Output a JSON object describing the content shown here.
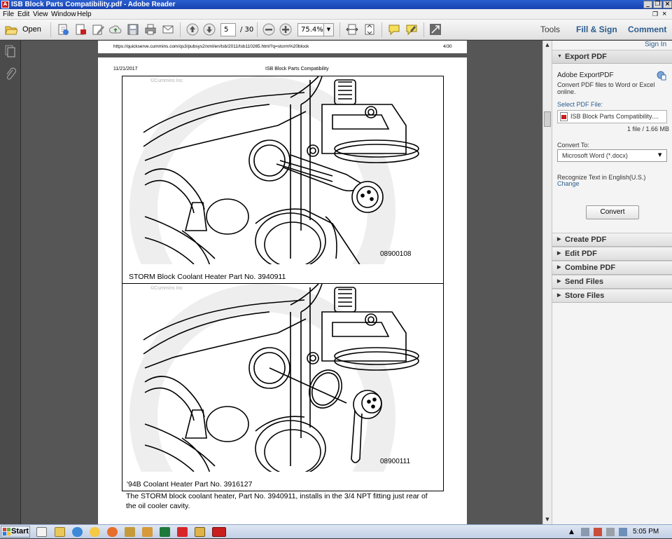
{
  "window": {
    "title": "ISB Block Parts Compatibility.pdf - Adobe Reader",
    "min_label": "_",
    "restore_label": "❐",
    "close_label": "×"
  },
  "menu": {
    "items": [
      "File",
      "Edit",
      "View",
      "Window",
      "Help"
    ],
    "doc_restore": "❐",
    "doc_close": "×"
  },
  "toolbar": {
    "open_label": "Open",
    "page_current": "5",
    "page_total": "/ 30",
    "zoom": "75.4%",
    "tools_label": "Tools",
    "fill_sign_label": "Fill & Sign",
    "comment_label": "Comment"
  },
  "document": {
    "prev_page_url": "https://quickserve.cummins.com/qs3/pubsys2/xml/en/tsb/2011/tsb110265.html?q=storm%20block",
    "prev_page_number": "4/30",
    "header_date": "11/21/2017",
    "header_title": "ISB Block Parts Compatibility",
    "figure1": {
      "watermark": "©Cummins Inc",
      "number": "08900108",
      "caption": "STORM   Block  Coolant Heater Part No. 3940911"
    },
    "figure2": {
      "watermark": "©Cummins Inc",
      "number": "08900111",
      "caption": "'94B Coolant Heater Part No. 3916127"
    },
    "body_text_line1": "The  STORM   block  coolant heater, Part No. 3940911, installs in the 3/4 NPT fitting just rear of",
    "body_text_line2": "the oil cooler cavity."
  },
  "right_pane": {
    "sign_in": "Sign In",
    "export_pdf": {
      "header": "Export PDF",
      "title": "Adobe ExportPDF",
      "description": "Convert PDF files to Word or Excel online.",
      "select_label": "Select PDF File:",
      "file_name": "ISB Block Parts Compatibility....",
      "file_info": "1 file / 1.66 MB",
      "convert_to_label": "Convert To:",
      "format": "Microsoft Word (*.docx)",
      "recognize_text": "Recognize Text in English(U.S.)",
      "change_link": "Change",
      "convert_button": "Convert"
    },
    "sections": [
      "Create PDF",
      "Edit PDF",
      "Combine PDF",
      "Send Files",
      "Store Files"
    ]
  },
  "taskbar": {
    "start_label": "Start",
    "clock": "5:05 PM"
  },
  "colors": {
    "title_bar": "#1f4fc0",
    "pdf_red": "#c81e1e",
    "link_blue": "#2c5d8e",
    "doc_background": "#565656"
  }
}
